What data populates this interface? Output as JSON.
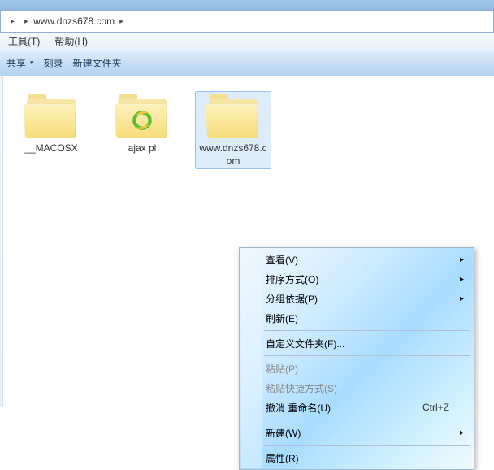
{
  "address": {
    "segment": "www.dnzs678.com"
  },
  "menu": {
    "tools": "工具(T)",
    "help": "帮助(H)"
  },
  "toolbar": {
    "share": "共享",
    "burn": "刻录",
    "new_folder": "新建文件夹"
  },
  "files": [
    {
      "label": "__MACOSX",
      "type": "folder"
    },
    {
      "label": "ajax pl",
      "type": "folder_ie"
    },
    {
      "label": "www.dnzs678.com",
      "type": "folder_page",
      "selected": true
    }
  ],
  "context_menu": {
    "items": [
      {
        "label": "查看(V)",
        "submenu": true
      },
      {
        "label": "排序方式(O)",
        "submenu": true
      },
      {
        "label": "分组依据(P)",
        "submenu": true
      },
      {
        "label": "刷新(E)"
      },
      {
        "sep": true
      },
      {
        "label": "自定义文件夹(F)..."
      },
      {
        "sep": true
      },
      {
        "label": "粘贴(P)",
        "disabled": true
      },
      {
        "label": "粘贴快捷方式(S)",
        "disabled": true
      },
      {
        "label": "撤消 重命名(U)",
        "shortcut": "Ctrl+Z"
      },
      {
        "sep": true
      },
      {
        "label": "新建(W)",
        "submenu": true
      },
      {
        "sep": true
      },
      {
        "label": "属性(R)"
      }
    ]
  }
}
